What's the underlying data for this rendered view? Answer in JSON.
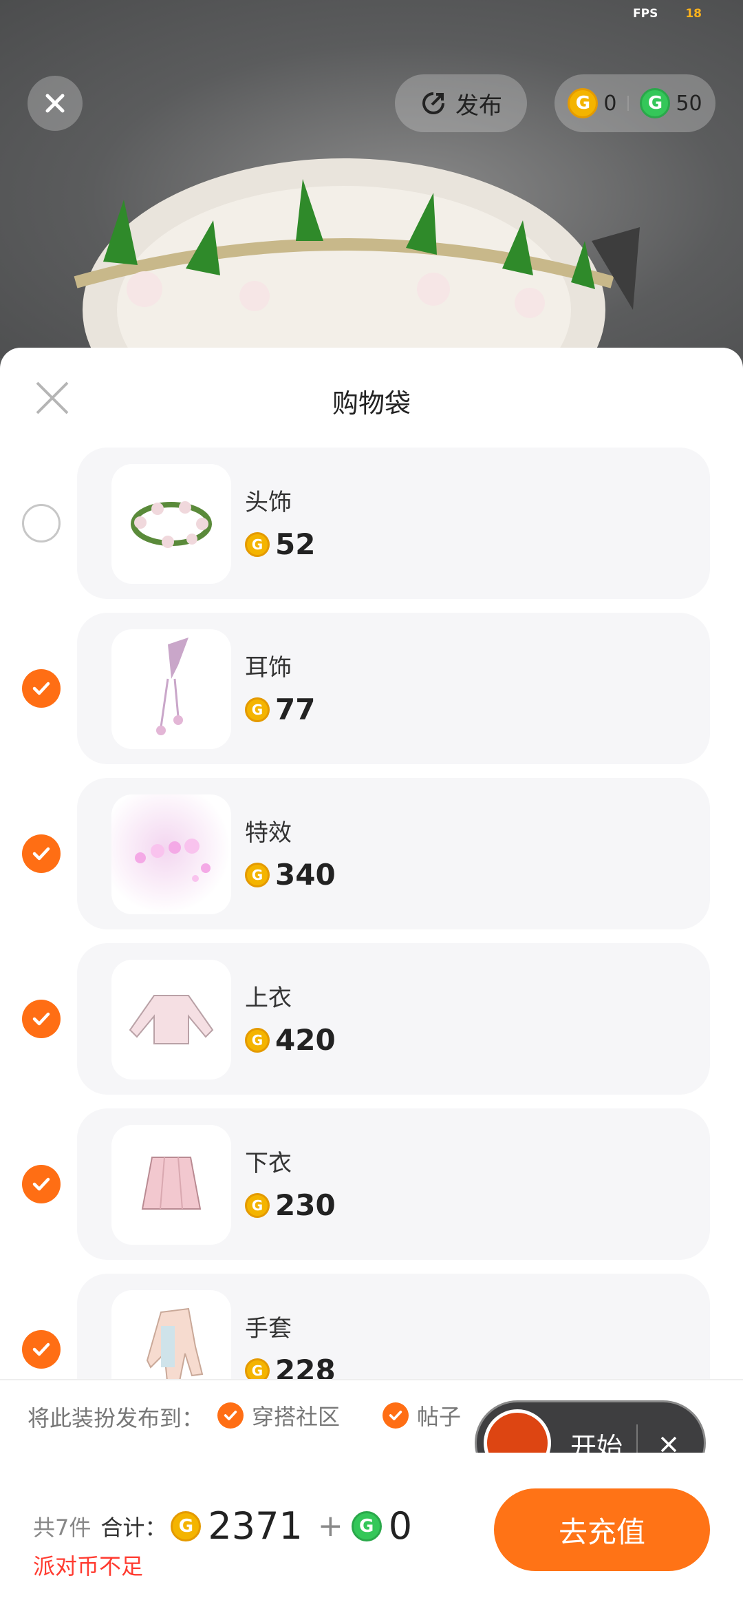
{
  "top": {
    "fps_label": "FPS",
    "fps_value": "18",
    "publish_label": "发布",
    "gold_balance": "0",
    "green_balance": "50"
  },
  "sheet": {
    "title": "购物袋"
  },
  "items": [
    {
      "name": "头饰",
      "price": "52",
      "checked": false,
      "icon": "flower-crown"
    },
    {
      "name": "耳饰",
      "price": "77",
      "checked": true,
      "icon": "earring"
    },
    {
      "name": "特效",
      "price": "340",
      "checked": true,
      "icon": "sparkle-effect"
    },
    {
      "name": "上衣",
      "price": "420",
      "checked": true,
      "icon": "sweater"
    },
    {
      "name": "下衣",
      "price": "230",
      "checked": true,
      "icon": "skirt"
    },
    {
      "name": "手套",
      "price": "228",
      "checked": true,
      "icon": "glove"
    }
  ],
  "publish_to": {
    "label": "将此装扮发布到：",
    "options": [
      {
        "label": "穿搭社区",
        "checked": true
      },
      {
        "label": "帖子",
        "checked": true
      }
    ]
  },
  "recorder": {
    "start_label": "开始"
  },
  "footer": {
    "count_text": "共7件",
    "total_label": "合计：",
    "gold_total": "2371",
    "plus": "+",
    "green_total": "0",
    "warning": "派对币不足",
    "recharge_label": "去充值"
  },
  "colors": {
    "accent": "#ff7316",
    "gold_coin": "#f4b400",
    "green_coin": "#34c759",
    "warning": "#ff3b30"
  }
}
